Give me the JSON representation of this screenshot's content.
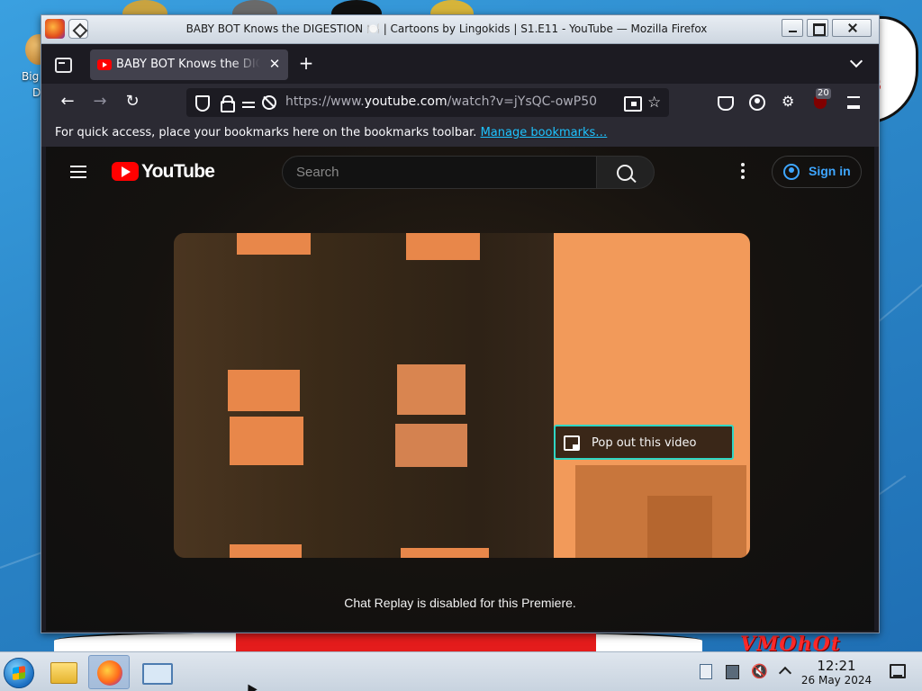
{
  "window": {
    "title": "BABY BOT Knows the DIGESTION 🍽️ | Cartoons by Lingokids | S1.E11 - YouTube — Mozilla Firefox"
  },
  "desktop": {
    "icon_label_line1": "Big",
    "icon_label_line2": "De",
    "corner_text": "VMOhOt"
  },
  "tabs": [
    {
      "label": "BABY BOT Knows the DIGESTION",
      "active": true,
      "favicon": "youtube-icon"
    }
  ],
  "navbar": {
    "url_prefix": "https://www.",
    "url_host": "youtube.com",
    "url_path": "/watch?v=jYsQC-owP50",
    "extension_badge": "20"
  },
  "bookmarks": {
    "message": "For quick access, place your bookmarks here on the bookmarks toolbar. ",
    "link": "Manage bookmarks…"
  },
  "youtube": {
    "logo_text": "YouTube",
    "search_placeholder": "Search",
    "sign_in": "Sign in",
    "pip_hint": "Pop out this video",
    "chat_note": "Chat Replay is disabled for this Premiere."
  },
  "taskbar": {
    "time": "12:21",
    "date": "26 May 2024"
  },
  "colors": {
    "accent_link": "#1ec3ff",
    "youtube_red": "#ff0000",
    "signin_blue": "#3ea6ff",
    "pip_outline": "#2fd6c4"
  }
}
